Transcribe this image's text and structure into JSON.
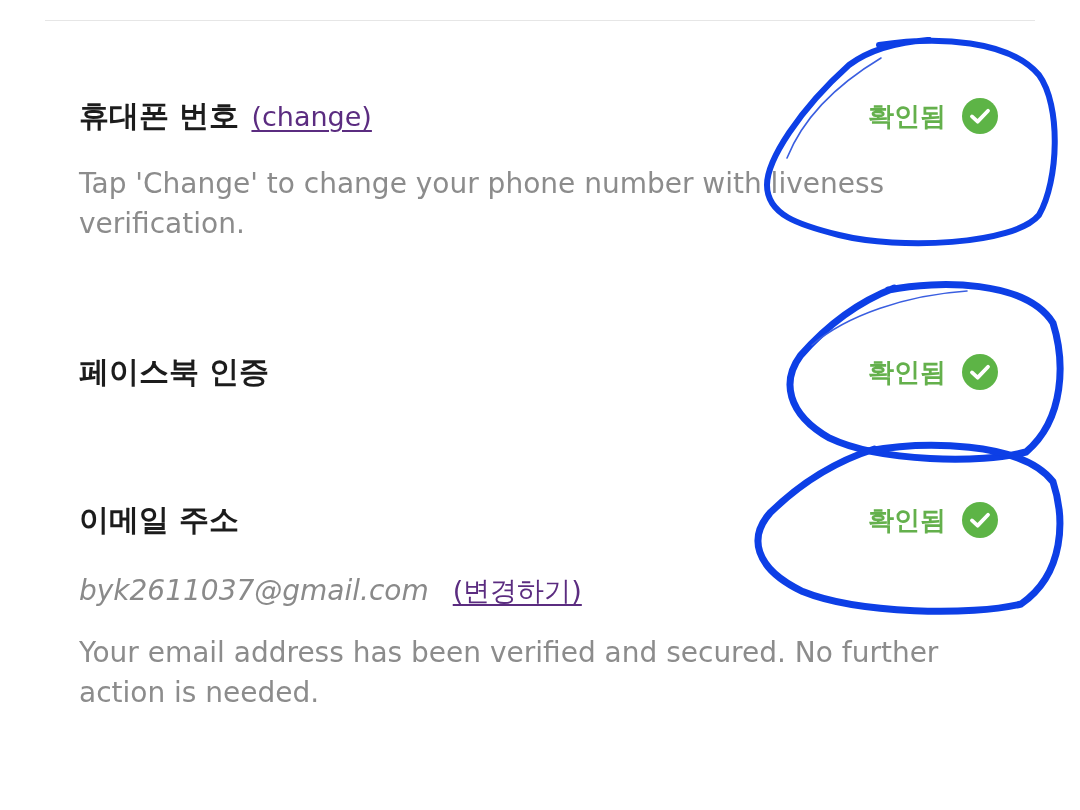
{
  "items": [
    {
      "title": "휴대폰 번호",
      "link": "(change)",
      "status": "확인됨",
      "verified": true,
      "circled": true,
      "description": "Tap 'Change' to change your phone number with liveness verification."
    },
    {
      "title": "페이스북 인증",
      "status": "확인됨",
      "verified": true,
      "circled": true
    },
    {
      "title": "이메일 주소",
      "status": "확인됨",
      "verified": true,
      "circled": true,
      "email": {
        "address": "byk2611037@gmail.com",
        "link": "(변경하기)"
      },
      "description": "Your email address has been verified and secured. No further action is needed."
    }
  ]
}
